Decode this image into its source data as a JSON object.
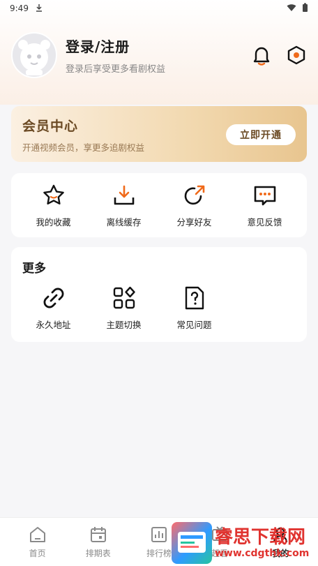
{
  "status_bar": {
    "time": "9:49",
    "download_icon": "download-icon",
    "wifi_icon": "wifi-icon",
    "battery_icon": "battery-icon"
  },
  "profile": {
    "title": "登录/注册",
    "subtitle": "登录后享受更多看剧权益",
    "avatar_icon": "avatar-mascot-icon",
    "bell_icon": "bell-icon",
    "settings_icon": "settings-hexagon-icon"
  },
  "vip": {
    "title": "会员中心",
    "subtitle": "开通视频会员，享更多追剧权益",
    "button": "立即开通"
  },
  "actions": [
    {
      "label": "我的收藏",
      "icon": "star-icon"
    },
    {
      "label": "离线缓存",
      "icon": "download-icon"
    },
    {
      "label": "分享好友",
      "icon": "share-icon"
    },
    {
      "label": "意见反馈",
      "icon": "feedback-icon"
    }
  ],
  "more": {
    "title": "更多",
    "items": [
      {
        "label": "永久地址",
        "icon": "link-icon"
      },
      {
        "label": "主题切换",
        "icon": "theme-grid-icon"
      },
      {
        "label": "常见问题",
        "icon": "faq-icon"
      }
    ]
  },
  "bottom_nav": [
    {
      "label": "首页",
      "icon": "home-icon"
    },
    {
      "label": "排期表",
      "icon": "calendar-icon"
    },
    {
      "label": "排行榜",
      "icon": "chart-icon"
    },
    {
      "label": "赶看",
      "icon": "tv-icon"
    },
    {
      "label": "我的",
      "icon": "user-icon",
      "active": true
    }
  ],
  "watermark": {
    "name": "睿思下载网",
    "url": "www.cdgthk.com"
  },
  "colors": {
    "accent": "#f06a1a",
    "vip_text": "#6b4a24",
    "watermark": "#e0332f"
  }
}
